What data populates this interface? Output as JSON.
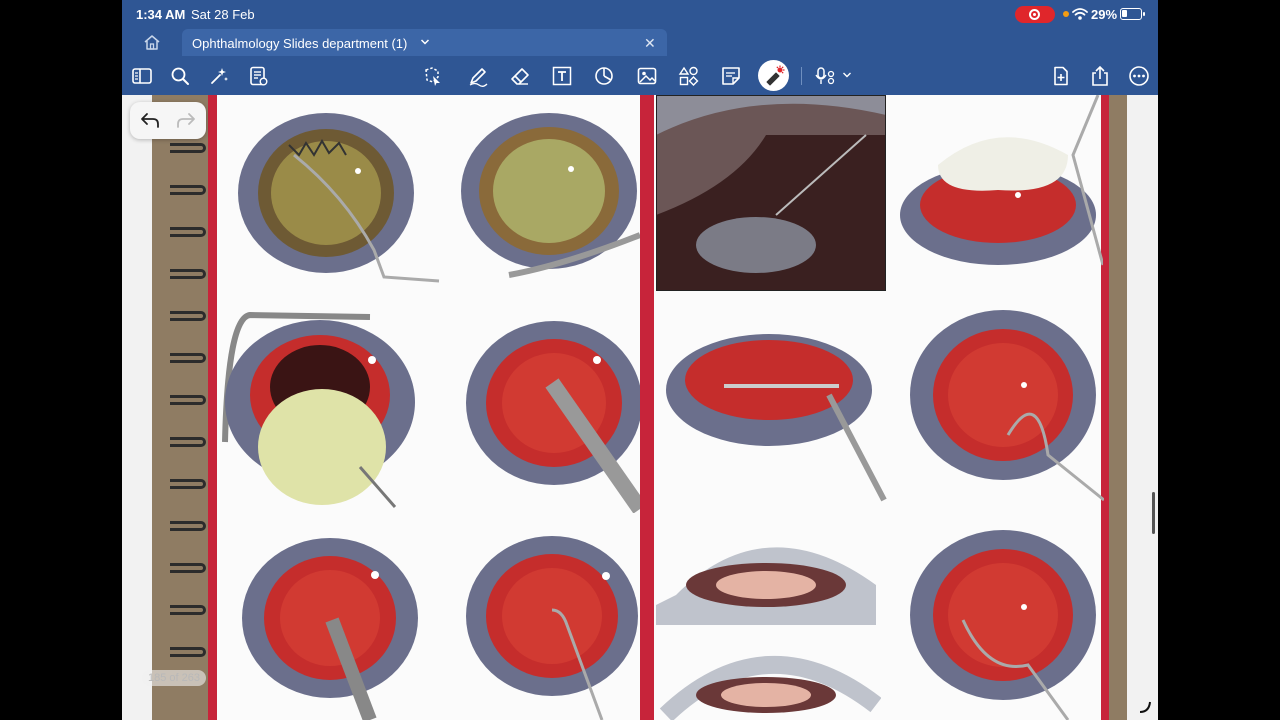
{
  "status_bar": {
    "time": "1:34 AM",
    "date": "Sat 28 Feb",
    "battery_percent": "29%"
  },
  "tab": {
    "title": "Ophthalmology Slides department (1)"
  },
  "toolbar": {
    "left_icons": [
      "sidebar-icon",
      "search-icon",
      "sparkle-icon",
      "document-summary-icon"
    ],
    "center_icons": [
      "lasso-icon",
      "pen-icon",
      "eraser-icon",
      "text-box-icon",
      "shapes-icon",
      "image-icon",
      "shapes-library-icon",
      "sticky-note-icon",
      "laser-pointer-icon",
      "audio-record-icon"
    ],
    "right_icons": [
      "add-page-icon",
      "share-icon",
      "more-icon"
    ],
    "active_tool": "laser-pointer-icon"
  },
  "page": {
    "indicator": "185 of 263"
  },
  "colors": {
    "header_blue": "#2f5694",
    "tab_blue": "#3c66a7",
    "slide_red": "#c7243a",
    "binder_brown": "#8f7c63"
  }
}
